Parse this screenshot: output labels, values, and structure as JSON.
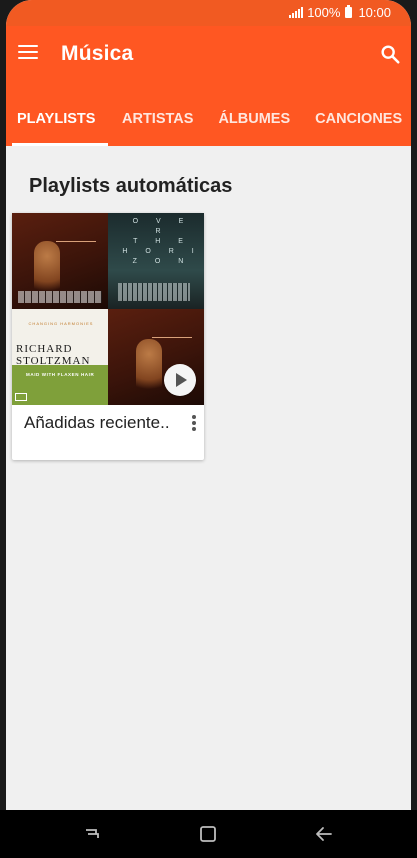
{
  "status_bar": {
    "battery_text": "100%",
    "time": "10:00",
    "icons": [
      "signal-icon",
      "battery-icon"
    ]
  },
  "app_bar": {
    "title": "Música",
    "icons": [
      "menu-icon",
      "search-icon"
    ]
  },
  "tabs": [
    {
      "label": "PLAYLISTS",
      "active": true
    },
    {
      "label": "ARTISTAS",
      "active": false
    },
    {
      "label": "ÁLBUMES",
      "active": false
    },
    {
      "label": "CANCIONES",
      "active": false
    }
  ],
  "section": {
    "title": "Playlists automáticas"
  },
  "playlist_card": {
    "title": "Añadidas reciente..",
    "art_texts": {
      "horizon_letters": [
        "O V E R",
        "T H E",
        "H O R I Z O N"
      ],
      "cover_label": "CHANGING HARMONIES",
      "cover_name_line1": "RICHARD",
      "cover_name_line2": "STOLTZMAN",
      "cover_subtitle": "MAID WITH FLAXEN HAIR"
    }
  },
  "colors": {
    "accent": "#ff5722",
    "status_bar": "#f15a22",
    "background": "#f0f0f0"
  },
  "nav_bar": {
    "icons": [
      "recent-apps-icon",
      "home-icon",
      "back-icon"
    ]
  }
}
